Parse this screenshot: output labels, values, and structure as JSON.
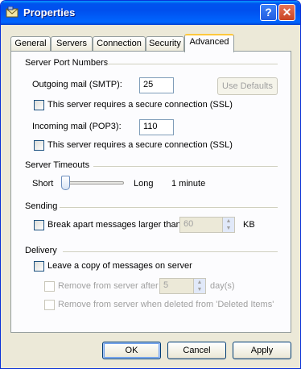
{
  "window": {
    "title": "Properties",
    "help_label": "?",
    "close_label": "✕"
  },
  "tabs": [
    {
      "label": "General"
    },
    {
      "label": "Servers"
    },
    {
      "label": "Connection"
    },
    {
      "label": "Security"
    },
    {
      "label": "Advanced"
    }
  ],
  "ports": {
    "group_title": "Server Port Numbers",
    "outgoing_label": "Outgoing mail (SMTP):",
    "outgoing_value": "25",
    "use_defaults": "Use Defaults",
    "ssl_label": "This server requires a secure connection (SSL)",
    "incoming_label": "Incoming mail (POP3):",
    "incoming_value": "110",
    "ssl2_label": "This server requires a secure connection (SSL)"
  },
  "timeouts": {
    "group_title": "Server Timeouts",
    "short_label": "Short",
    "long_label": "Long",
    "value_label": "1 minute",
    "slider_level": 0
  },
  "sending": {
    "group_title": "Sending",
    "break_label": "Break apart messages larger than",
    "break_value": "60",
    "unit": "KB"
  },
  "delivery": {
    "group_title": "Delivery",
    "leave_copy_label": "Leave a copy of messages on server",
    "remove_after_label": "Remove from server after",
    "remove_after_value": "5",
    "days_label": "day(s)",
    "remove_deleted_label": "Remove from server when deleted from 'Deleted Items'"
  },
  "buttons": {
    "ok": "OK",
    "cancel": "Cancel",
    "apply": "Apply"
  }
}
